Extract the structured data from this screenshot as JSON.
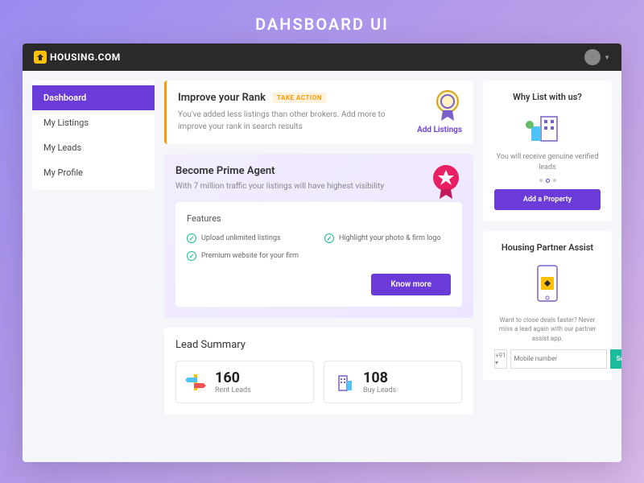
{
  "page_heading": "DAHSBOARD UI",
  "brand": "HOUSING.COM",
  "sidebar": {
    "items": [
      {
        "label": "Dashboard",
        "active": true
      },
      {
        "label": "My Listings",
        "active": false
      },
      {
        "label": "My Leads",
        "active": false
      },
      {
        "label": "My Profile",
        "active": false
      }
    ]
  },
  "rank": {
    "title": "Improve your Rank",
    "badge": "TAKE ACTION",
    "text": "You've added less listings than other brokers. Add more to improve your rank in search results",
    "link": "Add Listings"
  },
  "prime": {
    "title": "Become Prime Agent",
    "subtitle": "With 7 million traffic your listings will have highest visibility",
    "features_label": "Features",
    "features": [
      "Upload unlimited listings",
      "Highlight your photo & firm logo",
      "Premium website for your firm"
    ],
    "cta": "Know more"
  },
  "lead_summary": {
    "title": "Lead Summary",
    "items": [
      {
        "count": "160",
        "label": "Rent Leads"
      },
      {
        "count": "108",
        "label": "Buy Leads"
      }
    ]
  },
  "why": {
    "title": "Why List with us?",
    "text": "You will receive genuine verified leads",
    "cta": "Add a Property"
  },
  "assist": {
    "title": "Housing Partner Assist",
    "text": "Want to close deals faster? Never miss a lead again with our partner assist app.",
    "prefix": "+91 ▾",
    "placeholder": "Mobile number",
    "send": "Send"
  },
  "colors": {
    "primary": "#6b3bd9",
    "accent": "#1abc9c",
    "warn": "#ff9800"
  }
}
